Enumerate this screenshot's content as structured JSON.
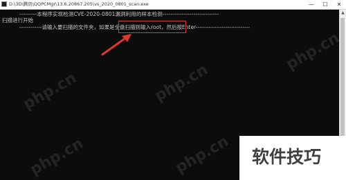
{
  "window": {
    "title": "D:\\3D\\腾讯\\QQPCMgr\\13.6.20867.205\\vs_2020_0801_scan.exe",
    "controls": {
      "minimize": "—",
      "maximize": "☐",
      "close": "✕"
    }
  },
  "console": {
    "lines": [
      "---------本程序实现检测CVE-2020-0801漏洞利用的样本检测-----------------------------",
      "扫描进行开始",
      "------------请输入要扫描的文件夹，如果是全盘扫描则输入root，然后按Enter-----------------------------"
    ]
  },
  "watermark": {
    "text": "php.cn"
  },
  "badge": {
    "text": "软件技巧"
  },
  "scrollbar": {
    "up": "▲",
    "down": "▼"
  },
  "colors": {
    "console_bg": "#0c0c0c",
    "console_text": "#c6c6c6",
    "highlight_border": "#d93a2b",
    "arrow": "#d93a2b"
  }
}
